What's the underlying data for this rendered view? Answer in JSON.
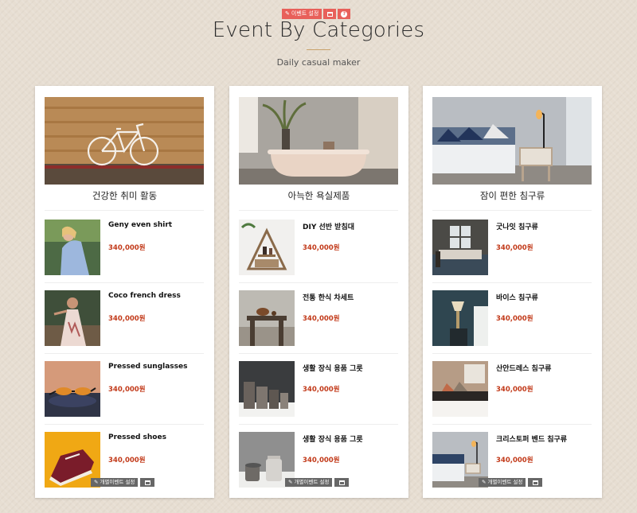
{
  "admin": {
    "event_settings_label": "이벤트 설정",
    "help_glyph": "?"
  },
  "header": {
    "title": "Event By Categories",
    "subtitle": "Daily casual maker"
  },
  "tools": {
    "individual_event_label": "개별이벤트 설정"
  },
  "icons": {
    "edit": "edit-icon",
    "window": "window-icon",
    "help": "help-icon"
  },
  "colors": {
    "accent_red": "#e8605a",
    "price_red": "#c23a1a",
    "tool_gray": "#676767"
  },
  "columns": [
    {
      "category": "건강한 취미 활동",
      "items": [
        {
          "name": "Geny even shirt",
          "price": "340,000원"
        },
        {
          "name": "Coco french dress",
          "price": "340,000원"
        },
        {
          "name": "Pressed sunglasses",
          "price": "340,000원"
        },
        {
          "name": "Pressed shoes",
          "price": "340,000원"
        }
      ]
    },
    {
      "category": "아늑한 욕실제품",
      "items": [
        {
          "name": "DIY 선반 받침대",
          "price": "340,000원"
        },
        {
          "name": "전통 한식 차세트",
          "price": "340,000원"
        },
        {
          "name": "생활 장식 용품 그릇",
          "price": "340,000원"
        },
        {
          "name": "생활 장식 용품 그릇",
          "price": "340,000원"
        }
      ]
    },
    {
      "category": "잠이 편한 침구류",
      "items": [
        {
          "name": "굿나잇 침구류",
          "price": "340,000원"
        },
        {
          "name": "바이스 침구류",
          "price": "340,000원"
        },
        {
          "name": "산안드레스 침구류",
          "price": "340,000원"
        },
        {
          "name": "크리스토퍼 벤드 침구류",
          "price": "340,000원"
        }
      ]
    }
  ]
}
